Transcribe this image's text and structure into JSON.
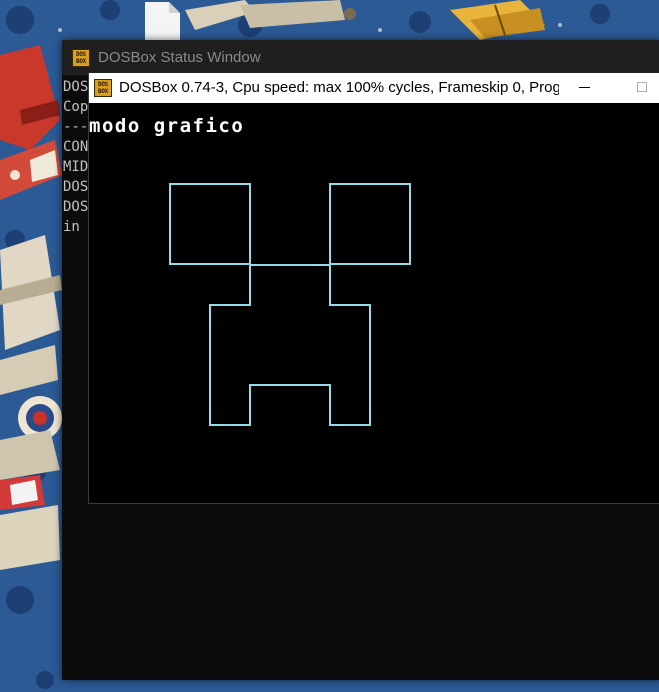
{
  "desktop": {
    "wallpaper_icon": "airplane-wallpaper",
    "file_icon": "file-icon"
  },
  "status_window": {
    "title": "DOSBox Status Window",
    "icon_text": "DOS BOX",
    "console_lines": [
      "DOS",
      "Cop",
      "---",
      "CON",
      "MID",
      "DOS",
      "DOS",
      "in"
    ]
  },
  "main_window": {
    "title": "DOSBox 0.74-3, Cpu speed: max 100% cycles, Frameskip  0, Prog...",
    "icon_text": "DOS BOX",
    "minimize_icon": "minimize-icon",
    "maximize_icon": "maximize-icon",
    "screen": {
      "text": "modo grafico",
      "drawing_color": "#8fdde6",
      "background": "#000000"
    }
  },
  "colors": {
    "status_titlebar": "#1f1f1f",
    "main_titlebar": "#ffffff",
    "console_text": "#c0c0c0"
  }
}
